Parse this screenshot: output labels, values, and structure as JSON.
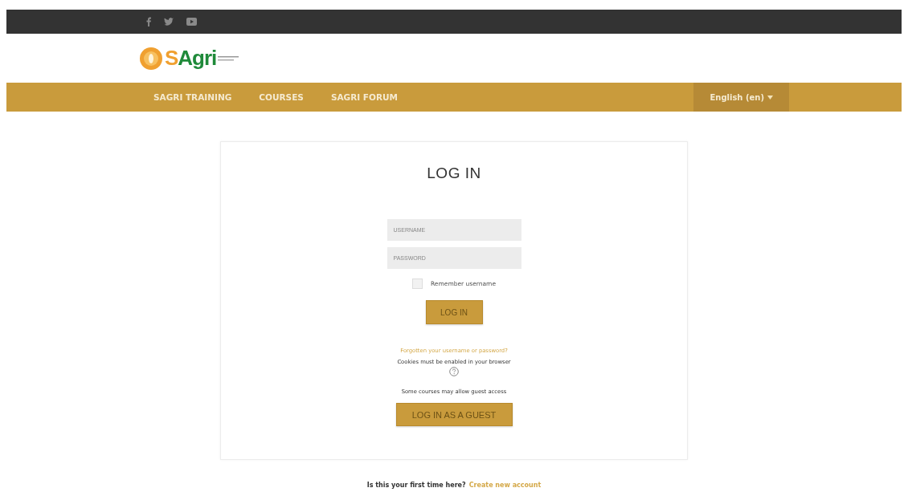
{
  "social_links": [
    {
      "kind": "facebook"
    },
    {
      "kind": "twitter"
    },
    {
      "kind": "youtube"
    }
  ],
  "logo": {
    "text": "SAgri"
  },
  "nav": {
    "items": [
      {
        "label": "SAGRI TRAINING"
      },
      {
        "label": "COURSES"
      },
      {
        "label": "SAGRI FORUM"
      }
    ],
    "language": "English (en)"
  },
  "login": {
    "title": "LOG IN",
    "fields": [
      {
        "placeholder": "USERNAME"
      },
      {
        "placeholder": "PASSWORD"
      }
    ],
    "remember": {
      "label": "Remember username",
      "checked": false
    },
    "submit": "LOG IN",
    "forgot_link": "Forgotten your username or password?",
    "cookies_note": "Cookies must be enabled in your browser",
    "guest_note": "Some courses may allow guest access",
    "guest_button": "LOG IN AS A GUEST"
  },
  "signup": {
    "question": "Is this your first time here?",
    "link": "Create new account"
  }
}
